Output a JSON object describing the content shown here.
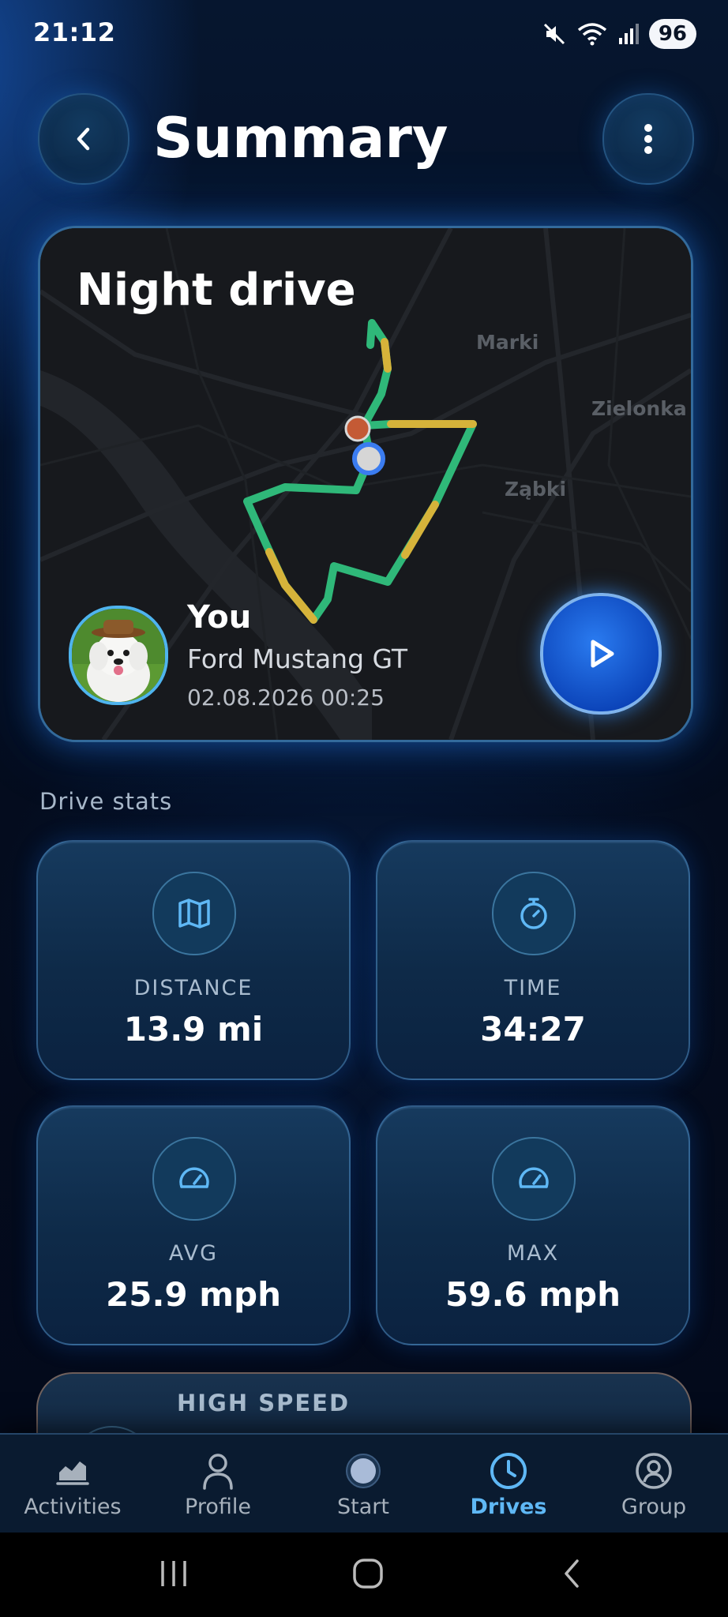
{
  "status_bar": {
    "time": "21:12",
    "battery": "96"
  },
  "header": {
    "title": "Summary"
  },
  "drive": {
    "title": "Night drive",
    "map_labels": [
      "Marki",
      "Zielonka",
      "Ząbki"
    ],
    "driver_name": "You",
    "car": "Ford Mustang GT",
    "datetime": "02.08.2026 00:25"
  },
  "stats": {
    "section_title": "Drive stats",
    "distance": {
      "label": "DISTANCE",
      "value": "13.9 mi"
    },
    "time": {
      "label": "TIME",
      "value": "34:27"
    },
    "avg": {
      "label": "AVG",
      "value": "25.9 mph"
    },
    "max": {
      "label": "MAX",
      "value": "59.6 mph"
    }
  },
  "high_speed": {
    "label": "HIGH SPEED"
  },
  "bottom_nav": {
    "items": [
      {
        "label": "Activities",
        "icon": "chart-icon",
        "active": false
      },
      {
        "label": "Profile",
        "icon": "person-icon",
        "active": false
      },
      {
        "label": "Start",
        "icon": "start-dot-icon",
        "active": false
      },
      {
        "label": "Drives",
        "icon": "clock-icon",
        "active": true
      },
      {
        "label": "Group",
        "icon": "group-icon",
        "active": false
      }
    ]
  },
  "colors": {
    "accent": "#5fb8f5",
    "route_green": "#2fb879",
    "route_yellow": "#d6b33a"
  }
}
